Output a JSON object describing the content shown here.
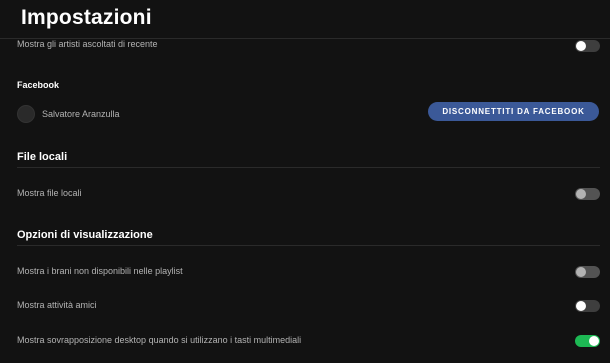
{
  "header": {
    "title": "Impostazioni"
  },
  "social": {
    "show_recent_artists_label": "Mostra gli artisti ascoltati di recente",
    "show_recent_artists_enabled": false
  },
  "facebook": {
    "section_title": "Facebook",
    "user_name": "Salvatore Aranzulla",
    "disconnect_button_label": "DISCONNETTITI DA FACEBOOK",
    "button_color": "#3b5998"
  },
  "local_files": {
    "section_title": "File locali",
    "show_local_files_label": "Mostra file locali",
    "show_local_files_enabled": false
  },
  "display_options": {
    "section_title": "Opzioni di visualizzazione",
    "items": [
      {
        "label": "Mostra i brani non disponibili nelle playlist",
        "enabled": false
      },
      {
        "label": "Mostra attività amici",
        "enabled": false
      },
      {
        "label": "Mostra sovrapposizione desktop quando si utilizzano i tasti multimediali",
        "enabled": true
      }
    ]
  },
  "colors": {
    "background": "#121212",
    "toggle_on": "#1db954",
    "toggle_off": "#535353",
    "text_primary": "#ffffff",
    "text_secondary": "#b3b3b3"
  }
}
